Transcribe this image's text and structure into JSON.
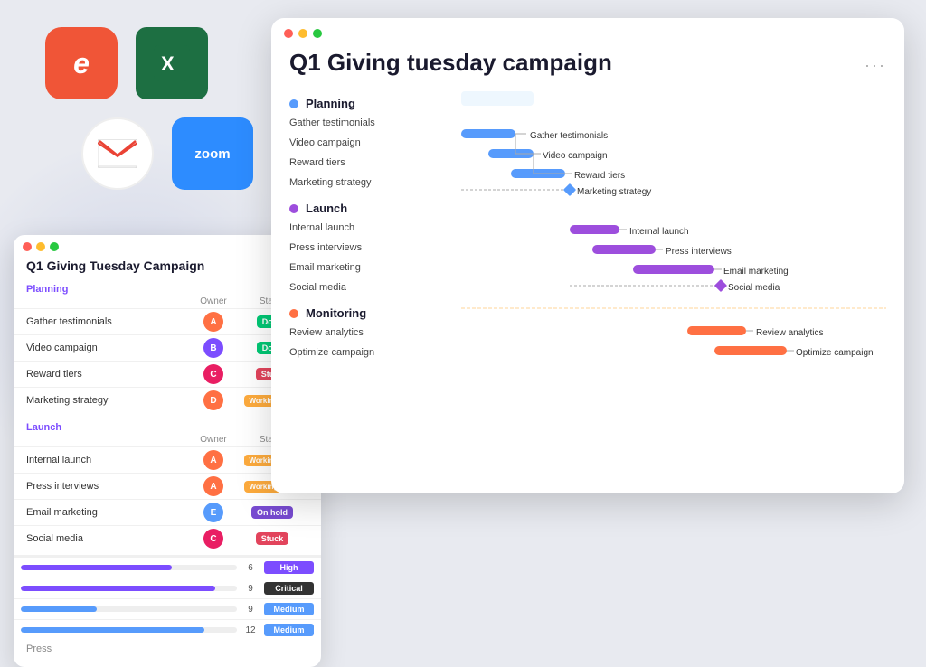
{
  "background": {
    "color": "#e8eaf0"
  },
  "app_icons": [
    {
      "id": "eventbrite",
      "letter": "e",
      "color": "#f05537",
      "label": "Eventbrite"
    },
    {
      "id": "excel",
      "letter": "X",
      "color": "#1d6f42",
      "label": "Excel"
    },
    {
      "id": "gmail",
      "letter": "M",
      "color": "white",
      "label": "Gmail"
    },
    {
      "id": "zoom",
      "letter": "zoom",
      "color": "#2d8cff",
      "label": "Zoom"
    }
  ],
  "small_window": {
    "title": "Q1 Giving Tuesday Campaign",
    "planning_label": "Planning",
    "planning_owner_header": "Owner",
    "planning_status_header": "Status",
    "planning_tasks": [
      {
        "name": "Gather testimonials",
        "avatar_color": "#ff7043",
        "avatar_letter": "A",
        "status": "Done",
        "badge": "done"
      },
      {
        "name": "Video campaign",
        "avatar_color": "#7c4dff",
        "avatar_letter": "B",
        "status": "Done",
        "badge": "done"
      },
      {
        "name": "Reward tiers",
        "avatar_color": "#e91e63",
        "avatar_letter": "C",
        "status": "Stuck",
        "badge": "stuck"
      },
      {
        "name": "Marketing strategy",
        "avatar_color": "#ff7043",
        "avatar_letter": "D",
        "status": "Working on it",
        "badge": "working"
      }
    ],
    "launch_label": "Launch",
    "launch_owner_header": "Owner",
    "launch_status_header": "Status",
    "launch_tasks": [
      {
        "name": "Internal launch",
        "avatar_color": "#ff7043",
        "avatar_letter": "A",
        "status": "Working on it",
        "badge": "working"
      },
      {
        "name": "Press interviews",
        "avatar_color": "#ff7043",
        "avatar_letter": "A",
        "status": "Working on it",
        "badge": "working"
      },
      {
        "name": "Email marketing",
        "avatar_color": "#579bfc",
        "avatar_letter": "E",
        "status": "On hold",
        "badge": "onhold"
      },
      {
        "name": "Social media",
        "avatar_color": "#e91e63",
        "avatar_letter": "C",
        "status": "Stuck",
        "badge": "stuck"
      }
    ],
    "priority_rows": [
      {
        "bar_pct": 70,
        "bar_color": "purple",
        "count": 6,
        "priority": "High",
        "badge": "high"
      },
      {
        "bar_pct": 90,
        "bar_color": "purple",
        "count": 9,
        "priority": "Critical",
        "badge": "critical"
      },
      {
        "bar_pct": 30,
        "bar_color": "blue",
        "count": 9,
        "priority": "Medium",
        "badge": "medium"
      },
      {
        "bar_pct": 85,
        "bar_color": "blue",
        "count": 12,
        "priority": "Medium",
        "badge": "medium"
      }
    ],
    "press_label": "Press"
  },
  "main_window": {
    "title": "Q1 Giving tuesday campaign",
    "more_icon": "···",
    "planning_label": "Planning",
    "launch_label": "Launch",
    "monitoring_label": "Monitoring",
    "tasks": {
      "planning": [
        "Gather testimonials",
        "Video campaign",
        "Reward tiers",
        "Marketing strategy"
      ],
      "launch": [
        "Internal launch",
        "Press interviews",
        "Email marketing",
        "Social media"
      ],
      "monitoring": [
        "Review analytics",
        "Optimize campaign"
      ]
    },
    "gantt_labels": {
      "gather_testimonials": "Gather testimonials",
      "video_campaign": "Video campaign",
      "reward_tiers": "Reward tiers",
      "marketing_strategy": "Marketing strategy",
      "internal_launch": "Internal launch",
      "press_interviews": "Press interviews",
      "email_marketing": "Email marketing",
      "social_media": "Social media",
      "review_analytics": "Review analytics",
      "optimize_campaign": "Optimize campaign"
    }
  }
}
